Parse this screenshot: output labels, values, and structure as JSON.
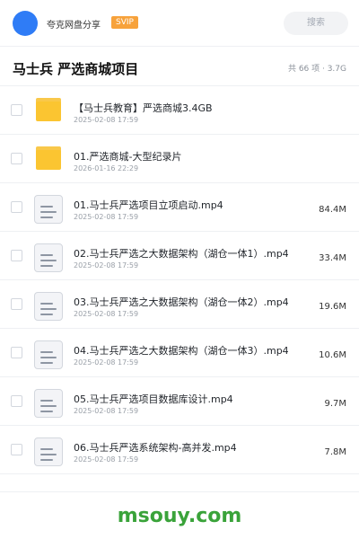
{
  "header": {
    "share_title": "夸克网盘分享",
    "vip_badge": "SVIP",
    "search_placeholder": "搜索",
    "avatar_color": "#2f7cf6"
  },
  "page": {
    "title": "马士兵 严选商城项目",
    "summary": "共 66 项 · 3.7G"
  },
  "files": [
    {
      "type": "folder",
      "icon": "folder-icon",
      "name": "【马士兵教育】严选商城3.4GB",
      "date": "2025-02-08 17:59",
      "size": ""
    },
    {
      "type": "folder",
      "icon": "folder-icon",
      "name": "01.严选商城-大型纪录片",
      "date": "2026-01-16 22:29",
      "size": ""
    },
    {
      "type": "video",
      "icon": "video-file-icon",
      "name": "01.马士兵严选项目立项启动.mp4",
      "date": "2025-02-08 17:59",
      "size": "84.4M"
    },
    {
      "type": "video",
      "icon": "video-file-icon",
      "name": "02.马士兵严选之大数据架构（湖仓一体1）.mp4",
      "date": "2025-02-08 17:59",
      "size": "33.4M"
    },
    {
      "type": "video",
      "icon": "video-file-icon",
      "name": "03.马士兵严选之大数据架构（湖仓一体2）.mp4",
      "date": "2025-02-08 17:59",
      "size": "19.6M"
    },
    {
      "type": "video",
      "icon": "video-file-icon",
      "name": "04.马士兵严选之大数据架构（湖仓一体3）.mp4",
      "date": "2025-02-08 17:59",
      "size": "10.6M"
    },
    {
      "type": "video",
      "icon": "video-file-icon",
      "name": "05.马士兵严选项目数据库设计.mp4",
      "date": "2025-02-08 17:59",
      "size": "9.7M"
    },
    {
      "type": "video",
      "icon": "video-file-icon",
      "name": "06.马士兵严选系统架构-高并发.mp4",
      "date": "2025-02-08 17:59",
      "size": "7.8M"
    }
  ],
  "watermark": {
    "text": "msouy.com",
    "color": "#3aa33a"
  },
  "colors": {
    "folder": "#fbc531",
    "vip_badge": "#f7a23b",
    "divider": "#eef0f3"
  }
}
